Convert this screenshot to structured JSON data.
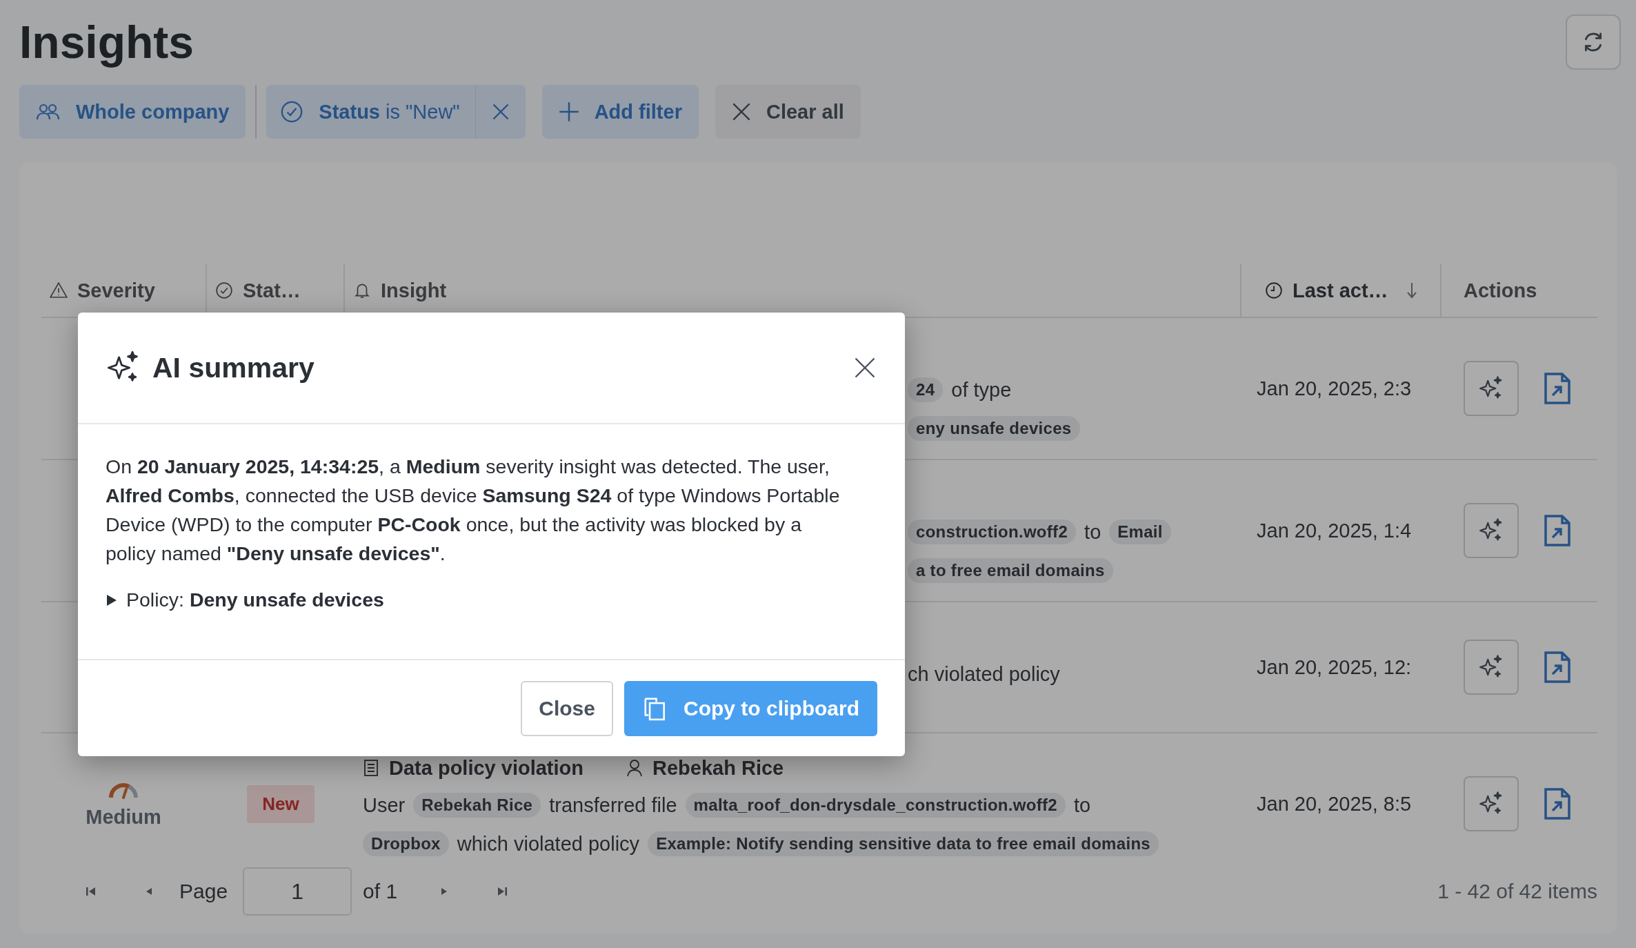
{
  "page": {
    "title": "Insights"
  },
  "filters": [
    {
      "kind": "scope",
      "label": "Whole company"
    },
    {
      "kind": "status",
      "label": "**Status** is \"New\"",
      "removable": true
    },
    {
      "kind": "add",
      "label": "Add filter"
    },
    {
      "kind": "clear",
      "label": "Clear all"
    }
  ],
  "table": {
    "columns": [
      {
        "kind": "severity",
        "label": "Severity",
        "sorted": false
      },
      {
        "kind": "status",
        "label": "Stat…",
        "sorted": false
      },
      {
        "kind": "insight",
        "label": "Insight",
        "sorted": false
      },
      {
        "kind": "last_activity",
        "label": "Last act…",
        "sorted": true
      },
      {
        "kind": "actions",
        "label": "Actions",
        "sorted": false
      }
    ],
    "rows": [
      {
        "lines": [
          [
            {
              "kind": "chip",
              "text": "24"
            },
            {
              "kind": "text",
              "text": "of type"
            }
          ],
          [
            {
              "kind": "chip",
              "text": "eny unsafe devices"
            }
          ]
        ],
        "last_activity": "Jan 20, 2025, 2:3"
      },
      {
        "lines": [
          [
            {
              "kind": "chip",
              "text": "construction.woff2"
            },
            {
              "kind": "text",
              "text": "to"
            },
            {
              "kind": "chip",
              "text": "Email"
            }
          ],
          [
            {
              "kind": "chip",
              "text": "a to free email domains"
            }
          ]
        ],
        "last_activity": "Jan 20, 2025, 1:4"
      },
      {
        "lines": [
          [
            {
              "kind": "text",
              "text": "ch violated policy"
            }
          ]
        ],
        "last_activity": "Jan 20, 2025, 12:"
      },
      {
        "severity": "Medium",
        "status": "New",
        "title": "Data policy violation",
        "user": "Rebekah Rice",
        "lines": [
          [
            {
              "kind": "text",
              "text": "User"
            },
            {
              "kind": "chip",
              "text": "Rebekah Rice"
            },
            {
              "kind": "text",
              "text": "transferred file"
            },
            {
              "kind": "chip",
              "text": "malta_roof_don-drysdale_construction.woff2"
            },
            {
              "kind": "text",
              "text": "to"
            }
          ],
          [
            {
              "kind": "chip",
              "text": "Dropbox"
            },
            {
              "kind": "text",
              "text": "which violated policy"
            },
            {
              "kind": "chip",
              "text": "Example: Notify sending sensitive data to free email domains"
            }
          ]
        ],
        "last_activity": "Jan 20, 2025, 8:5"
      }
    ]
  },
  "pagination": {
    "label": "Page",
    "page": "1",
    "of": "of 1",
    "summary": "1 - 42 of 42 items"
  },
  "modal": {
    "title": "AI summary",
    "text": "On **20 January 2025, 14:34:25**, a **Medium** severity insight was detected. The user, **Alfred Combs**, connected the USB device **Samsung S24** of type Windows Portable Device (WPD) to the computer **PC-Cook** once, but the activity was blocked by a policy named **\"Deny unsafe devices\"**.",
    "policy": {
      "label": "Policy: **Deny unsafe devices**",
      "expanded": false
    },
    "buttons": [
      {
        "kind": "secondary",
        "label": "Close"
      },
      {
        "kind": "primary",
        "label": "Copy to clipboard"
      }
    ]
  }
}
